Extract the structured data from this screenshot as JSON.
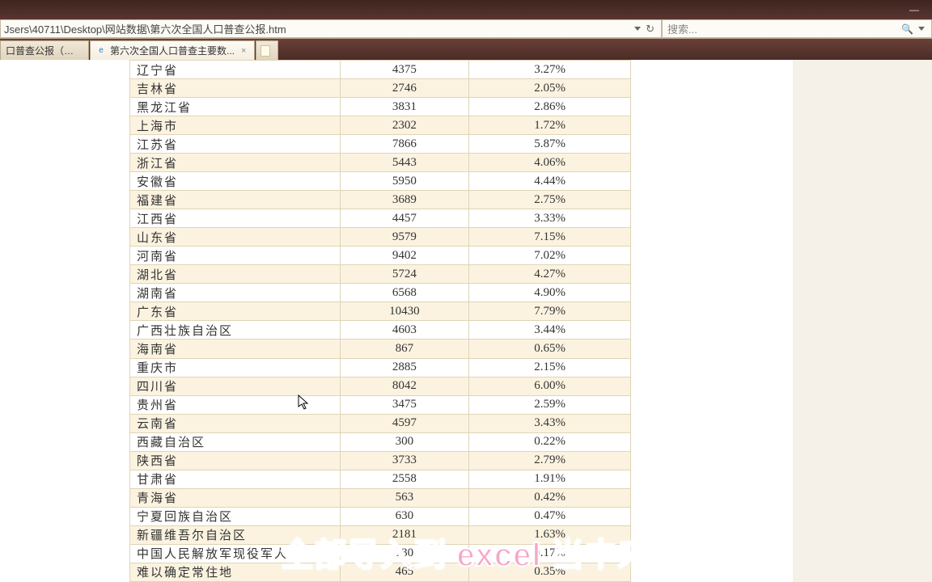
{
  "titlebar": {
    "minimize": "—"
  },
  "address": {
    "path": "Jsers\\40711\\Desktop\\网站数据\\第六次全国人口普查公报.htm"
  },
  "search": {
    "placeholder": "搜索..."
  },
  "tabs": {
    "inactive_label": "口普查公报（第1...",
    "active_label": "第六次全国人口普查主要数...",
    "close": "×"
  },
  "table": {
    "rows": [
      {
        "name": "辽宁省",
        "value": "4375",
        "pct": "3.27%"
      },
      {
        "name": "吉林省",
        "value": "2746",
        "pct": "2.05%"
      },
      {
        "name": "黑龙江省",
        "value": "3831",
        "pct": "2.86%"
      },
      {
        "name": "上海市",
        "value": "2302",
        "pct": "1.72%"
      },
      {
        "name": "江苏省",
        "value": "7866",
        "pct": "5.87%"
      },
      {
        "name": "浙江省",
        "value": "5443",
        "pct": "4.06%"
      },
      {
        "name": "安徽省",
        "value": "5950",
        "pct": "4.44%"
      },
      {
        "name": "福建省",
        "value": "3689",
        "pct": "2.75%"
      },
      {
        "name": "江西省",
        "value": "4457",
        "pct": "3.33%"
      },
      {
        "name": "山东省",
        "value": "9579",
        "pct": "7.15%"
      },
      {
        "name": "河南省",
        "value": "9402",
        "pct": "7.02%"
      },
      {
        "name": "湖北省",
        "value": "5724",
        "pct": "4.27%"
      },
      {
        "name": "湖南省",
        "value": "6568",
        "pct": "4.90%"
      },
      {
        "name": "广东省",
        "value": "10430",
        "pct": "7.79%"
      },
      {
        "name": "广西壮族自治区",
        "value": "4603",
        "pct": "3.44%"
      },
      {
        "name": "海南省",
        "value": "867",
        "pct": "0.65%"
      },
      {
        "name": "重庆市",
        "value": "2885",
        "pct": "2.15%"
      },
      {
        "name": "四川省",
        "value": "8042",
        "pct": "6.00%"
      },
      {
        "name": "贵州省",
        "value": "3475",
        "pct": "2.59%"
      },
      {
        "name": "云南省",
        "value": "4597",
        "pct": "3.43%"
      },
      {
        "name": "西藏自治区",
        "value": "300",
        "pct": "0.22%"
      },
      {
        "name": "陕西省",
        "value": "3733",
        "pct": "2.79%"
      },
      {
        "name": "甘肃省",
        "value": "2558",
        "pct": "1.91%"
      },
      {
        "name": "青海省",
        "value": "563",
        "pct": "0.42%"
      },
      {
        "name": "宁夏回族自治区",
        "value": "630",
        "pct": "0.47%"
      },
      {
        "name": "新疆维吾尔自治区",
        "value": "2181",
        "pct": "1.63%"
      },
      {
        "name": "中国人民解放军现役军人",
        "value": "230",
        "pct": "0.17%"
      },
      {
        "name": "难以确定常住地",
        "value": "465",
        "pct": "0.35%"
      }
    ]
  },
  "subtitle": "全部导入到 excel 当中来"
}
